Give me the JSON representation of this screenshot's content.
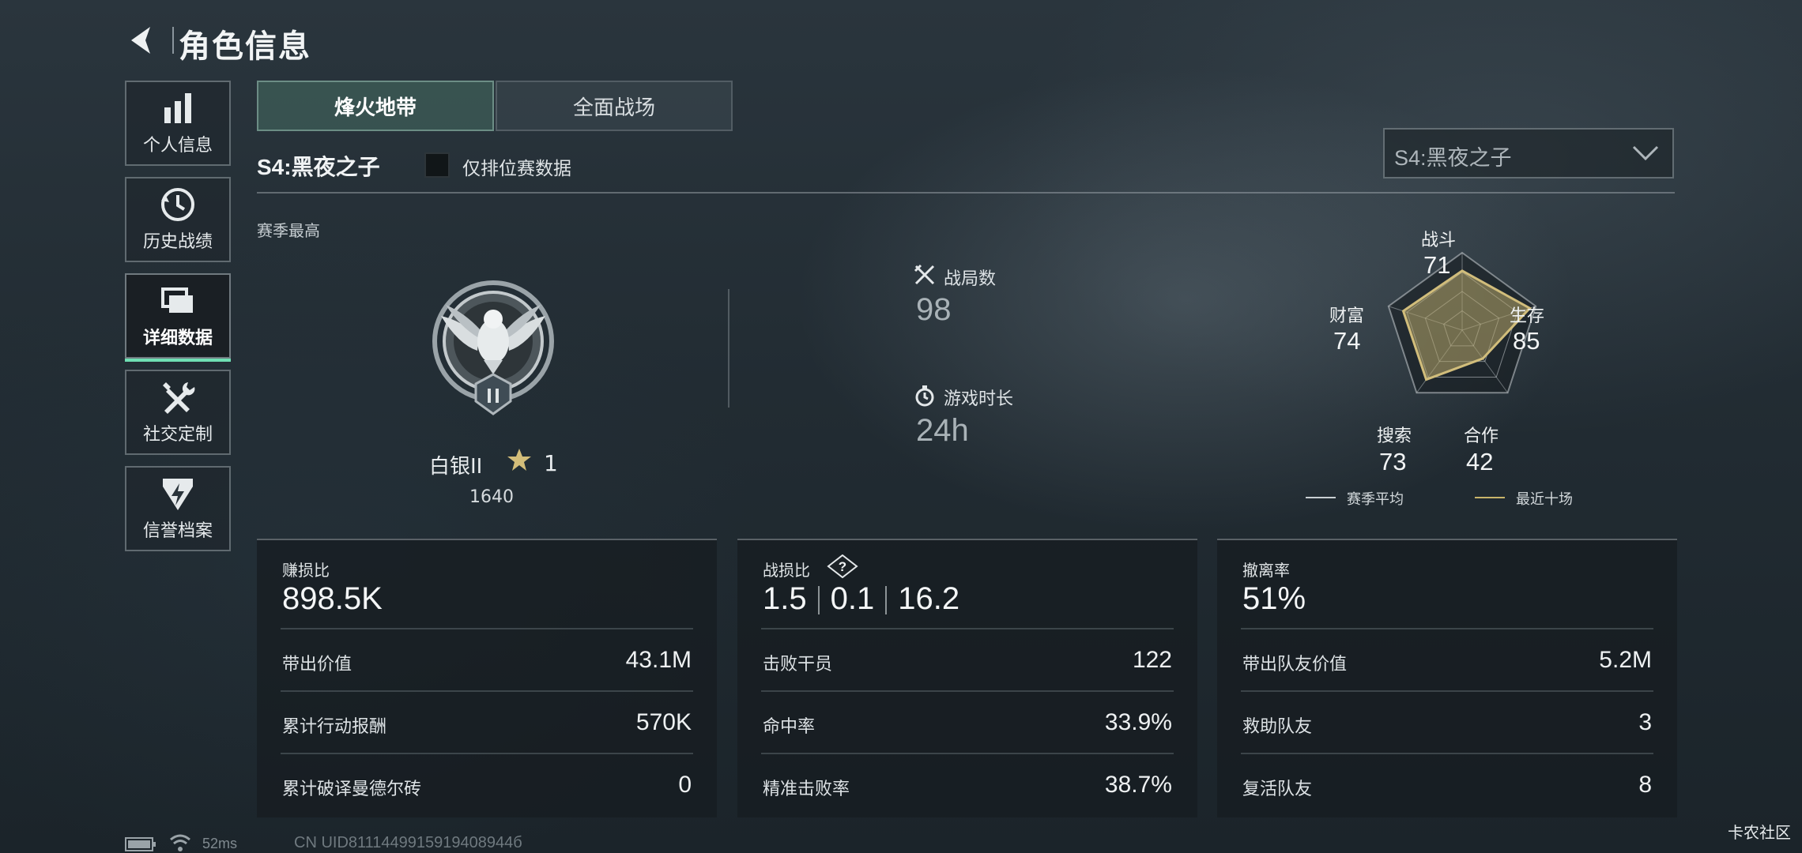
{
  "header": {
    "title": "角色信息"
  },
  "sidebar": {
    "items": [
      {
        "label": "个人信息",
        "icon": "bar-chart-icon"
      },
      {
        "label": "历史战绩",
        "icon": "history-icon"
      },
      {
        "label": "详细数据",
        "icon": "folder-icon",
        "active": true
      },
      {
        "label": "社交定制",
        "icon": "tools-icon"
      },
      {
        "label": "信誉档案",
        "icon": "shield-bolt-icon"
      }
    ]
  },
  "tabs": [
    {
      "label": "烽火地带",
      "active": true
    },
    {
      "label": "全面战场",
      "active": false
    }
  ],
  "filter": {
    "season_label": "S4:黑夜之子",
    "ranked_only_label": "仅排位赛数据",
    "ranked_only_checked": false,
    "season_select_value": "S4:黑夜之子"
  },
  "season_peak": {
    "label": "赛季最高",
    "rank_name": "白银II",
    "stars": "1",
    "score": "1640"
  },
  "summary": {
    "matches_label": "战局数",
    "matches_value": "98",
    "playtime_label": "游戏时长",
    "playtime_value": "24h"
  },
  "radar": {
    "axes": [
      {
        "name": "战斗",
        "value": "71"
      },
      {
        "name": "生存",
        "value": "85"
      },
      {
        "name": "合作",
        "value": "42"
      },
      {
        "name": "搜索",
        "value": "73"
      },
      {
        "name": "财富",
        "value": "74"
      }
    ],
    "legend": [
      {
        "label": "赛季平均",
        "color": "#c9cfd2"
      },
      {
        "label": "最近十场",
        "color": "#c8b46a"
      }
    ],
    "fill_color": "#b7a56a"
  },
  "cards": {
    "profit": {
      "title": "赚损比",
      "value": "898.5K",
      "rows": [
        {
          "label": "带出价值",
          "value": "43.1M"
        },
        {
          "label": "累计行动报酬",
          "value": "570K"
        },
        {
          "label": "累计破译曼德尔砖",
          "value": "0"
        }
      ]
    },
    "combat": {
      "title": "战损比",
      "values": [
        "1.5",
        "0.1",
        "16.2"
      ],
      "rows": [
        {
          "label": "击败干员",
          "value": "122"
        },
        {
          "label": "命中率",
          "value": "33.9%"
        },
        {
          "label": "精准击败率",
          "value": "38.7%"
        }
      ]
    },
    "extract": {
      "title": "撤离率",
      "value": "51%",
      "rows": [
        {
          "label": "带出队友价值",
          "value": "5.2M"
        },
        {
          "label": "救助队友",
          "value": "3"
        },
        {
          "label": "复活队友",
          "value": "8"
        }
      ]
    }
  },
  "status": {
    "ping": "52ms",
    "uid": "CN UID8111449915919408944б",
    "watermark": "卡农社区"
  }
}
